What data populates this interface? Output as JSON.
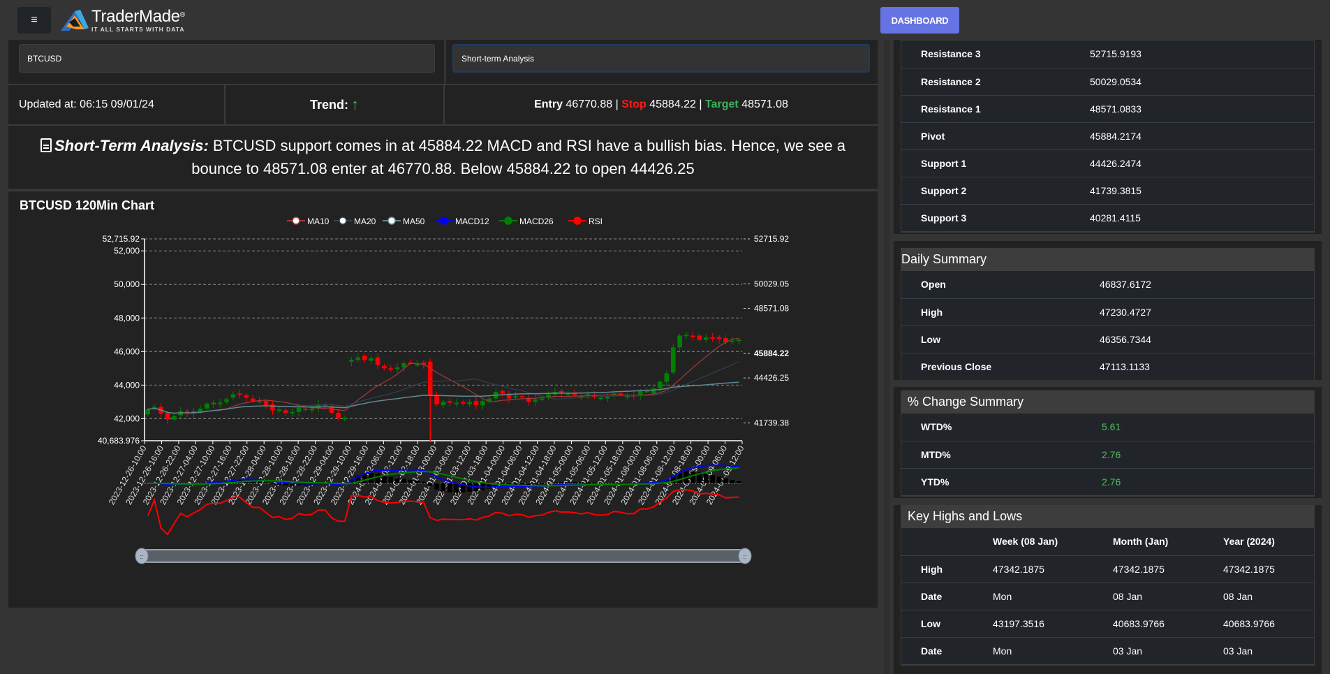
{
  "header": {
    "menu_icon": "hamburger-menu-icon",
    "logo_name": "TraderMade",
    "logo_registered": "®",
    "logo_tagline": "IT ALL STARTS WITH DATA",
    "dashboard_label": "DASHBOARD"
  },
  "selectors": {
    "symbol": "BTCUSD",
    "analysis_type": "Short-term Analysis"
  },
  "info": {
    "updated": "Updated at: 06:15 09/01/24",
    "trend_label": "Trend:",
    "trend_icon": "arrow-up-icon",
    "trend_glyph": "🡑",
    "entry_label": "Entry",
    "entry_value": "46770.88",
    "stop_label": "Stop",
    "stop_value": "45884.22",
    "target_label": "Target",
    "target_value": "48571.08",
    "separator": "|"
  },
  "analysis": {
    "title": "Short-Term Analysis:",
    "text": "BTCUSD support comes in at 45884.22 MACD and RSI have a bullish bias. Hence, we see a bounce to 48571.08 enter at 46770.88. Below 45884.22 to open 44426.25"
  },
  "colors": {
    "accent": "#6673e3",
    "up": "#008000",
    "down": "#ff0000",
    "positive": "#4cbf5e",
    "ma10": "#a33a3a",
    "ma20": "#2f4250",
    "ma50": "#5f8a94",
    "macd12": "#0000ff",
    "macd26": "#008000",
    "rsi": "#ff0000"
  },
  "chart_data": {
    "type": "candlestick",
    "title": "BTCUSD 120Min Chart",
    "legend": [
      "MA10",
      "MA20",
      "MA50",
      "MACD12",
      "MACD26",
      "RSI"
    ],
    "legend_position": "top-center",
    "ylim": [
      40683.976,
      52715.92
    ],
    "y_ticks": [
      "52,715.92",
      "52,000",
      "50,000",
      "48,000",
      "46,000",
      "44,000",
      "42,000",
      "40,683.976"
    ],
    "y_tick_values": [
      52715.92,
      52000,
      50000,
      48000,
      46000,
      44000,
      42000,
      40683.976
    ],
    "levels": [
      52715.92,
      50029.05,
      48571.08,
      45884.22,
      44426.25,
      41739.38
    ],
    "level_labels": [
      "52715.92",
      "50029.05",
      "48571.08",
      "45884.22",
      "44426.25",
      "41739.38"
    ],
    "x_labels": [
      "2023-12-26-10:00",
      "2023-12-26-16:00",
      "2023-12-26-22:00",
      "2023-12-27-04:00",
      "2023-12-27-10:00",
      "2023-12-27-16:00",
      "2023-12-27-22:00",
      "2023-12-28-04:00",
      "2023-12-28-10:00",
      "2023-12-28-16:00",
      "2023-12-28-22:00",
      "2023-12-29-04:00",
      "2023-12-29-10:00",
      "2023-12-29-16:00",
      "2024-01-02-06:00",
      "2024-01-02-12:00",
      "2024-01-02-18:00",
      "2024-01-03-00:00",
      "2024-01-03-06:00",
      "2024-01-03-12:00",
      "2024-01-03-18:00",
      "2024-01-04-00:00",
      "2024-01-04-06:00",
      "2024-01-04-12:00",
      "2024-01-04-18:00",
      "2024-01-05-00:00",
      "2024-01-05-06:00",
      "2024-01-05-12:00",
      "2024-01-05-18:00",
      "2024-01-08-00:00",
      "2024-01-08-06:00",
      "2024-01-08-12:00",
      "2024-01-08-18:00",
      "2024-01-09-00:00",
      "2024-01-09-06:00",
      "2024-01-09-12:00"
    ],
    "candles_close": [
      42550,
      42700,
      42300,
      41950,
      42150,
      42450,
      42300,
      42450,
      42600,
      42900,
      42950,
      42950,
      43150,
      43450,
      43450,
      43250,
      43050,
      43050,
      42800,
      42500,
      42550,
      42350,
      42400,
      42650,
      42550,
      42600,
      42850,
      42850,
      42350,
      42050,
      42050,
      45500,
      45650,
      45500,
      45600,
      45200,
      45000,
      44950,
      45050,
      45300,
      45300,
      45250,
      45200,
      43350,
      42850,
      43000,
      42950,
      42950,
      42900,
      43000,
      42800,
      43050,
      43200,
      43600,
      43500,
      43200,
      43350,
      43300,
      43000,
      43150,
      43200,
      43450,
      43600,
      43500,
      43500,
      43450,
      43350,
      43450,
      43300,
      43250,
      43300,
      43500,
      43450,
      43350,
      43350,
      43650,
      43650,
      43800,
      44200,
      44700,
      46250,
      46950,
      47000,
      46900,
      46700,
      46850,
      46800,
      46750,
      46550,
      46650,
      46700
    ],
    "candles_open": [
      42250,
      42650,
      42700,
      42350,
      41950,
      42200,
      42450,
      42300,
      42400,
      42600,
      42850,
      42900,
      43000,
      43250,
      43500,
      43400,
      43200,
      43050,
      43050,
      42850,
      42450,
      42500,
      42350,
      42400,
      42600,
      42500,
      42600,
      42800,
      42750,
      42350,
      42050,
      45400,
      45500,
      45750,
      45450,
      45650,
      45150,
      45000,
      44950,
      45050,
      45350,
      45250,
      45350,
      45400,
      43350,
      42800,
      43050,
      42950,
      43000,
      42850,
      43050,
      42800,
      43050,
      43200,
      43650,
      43500,
      43300,
      43350,
      43250,
      43000,
      43150,
      43250,
      43450,
      43650,
      43450,
      43500,
      43300,
      43450,
      43400,
      43250,
      43200,
      43450,
      43500,
      43300,
      43400,
      43350,
      43650,
      43500,
      43800,
      44200,
      44750,
      46250,
      46950,
      46950,
      46950,
      46700,
      46850,
      46850,
      46800,
      46600,
      46650
    ],
    "ma10_trend": "rising",
    "indicator_panel": {
      "series": [
        "MACD12",
        "MACD26",
        "Histogram",
        "RSI"
      ]
    }
  },
  "pivot_levels": [
    {
      "label": "Resistance 3",
      "value": "52715.9193"
    },
    {
      "label": "Resistance 2",
      "value": "50029.0534"
    },
    {
      "label": "Resistance 1",
      "value": "48571.0833"
    },
    {
      "label": "Pivot",
      "value": "45884.2174"
    },
    {
      "label": "Support 1",
      "value": "44426.2474"
    },
    {
      "label": "Support 2",
      "value": "41739.3815"
    },
    {
      "label": "Support 3",
      "value": "40281.4115"
    }
  ],
  "daily_summary": {
    "title": "Daily Summary",
    "rows": [
      {
        "label": "Open",
        "value": "46837.6172"
      },
      {
        "label": "High",
        "value": "47230.4727"
      },
      {
        "label": "Low",
        "value": "46356.7344"
      },
      {
        "label": "Previous Close",
        "value": "47113.1133"
      }
    ]
  },
  "change_summary": {
    "title": "% Change Summary",
    "rows": [
      {
        "label": "WTD%",
        "value": "5.61"
      },
      {
        "label": "MTD%",
        "value": "2.76"
      },
      {
        "label": "YTD%",
        "value": "2.76"
      }
    ]
  },
  "key_highs_lows": {
    "title": "Key Highs and Lows",
    "columns": [
      "",
      "Week (08 Jan)",
      "Month (Jan)",
      "Year (2024)"
    ],
    "rows": [
      {
        "label": "High",
        "values": [
          "47342.1875",
          "47342.1875",
          "47342.1875"
        ]
      },
      {
        "label": "Date",
        "values": [
          "Mon",
          "08 Jan",
          "08 Jan"
        ]
      },
      {
        "label": "Low",
        "values": [
          "43197.3516",
          "40683.9766",
          "40683.9766"
        ]
      },
      {
        "label": "Date",
        "values": [
          "Mon",
          "03 Jan",
          "03 Jan"
        ]
      }
    ]
  }
}
